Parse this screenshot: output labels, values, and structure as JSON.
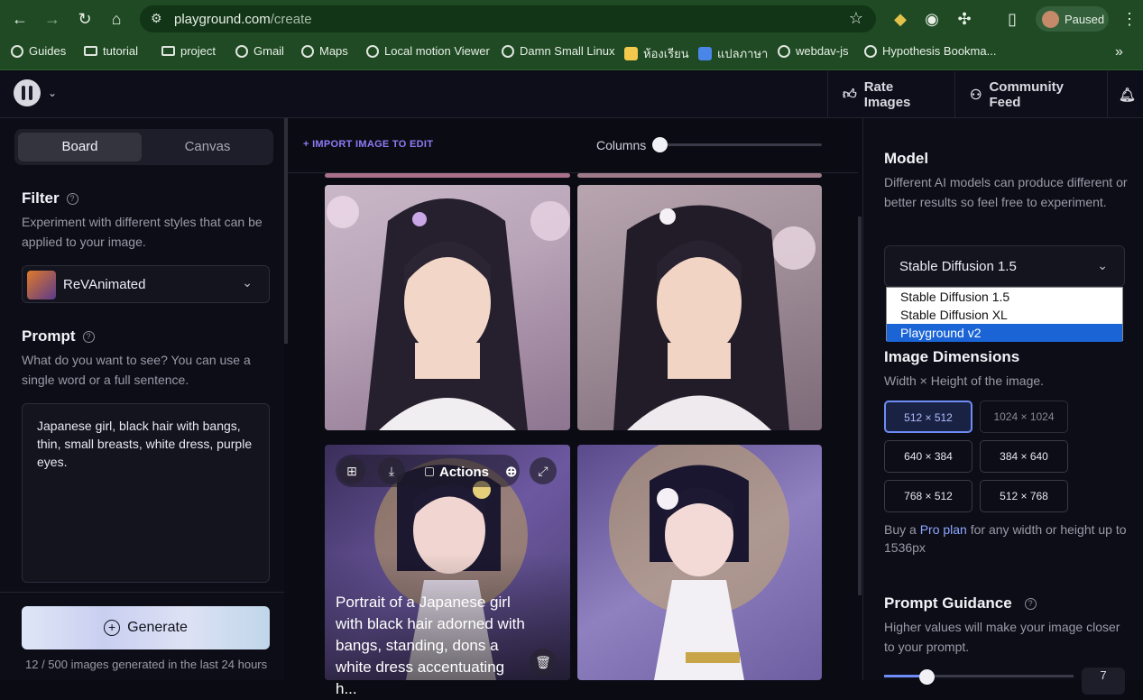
{
  "browser": {
    "url_host": "playground.com",
    "url_path": "/create",
    "profile_label": "Paused",
    "bookmarks": [
      {
        "label": "Guides",
        "icon": "globe-icon"
      },
      {
        "label": "tutorial",
        "icon": "folder-icon"
      },
      {
        "label": "project",
        "icon": "folder-icon"
      },
      {
        "label": "Gmail",
        "icon": "globe-icon"
      },
      {
        "label": "Maps",
        "icon": "globe-icon"
      },
      {
        "label": "Local motion Viewer",
        "icon": "globe-icon"
      },
      {
        "label": "Damn Small Linux",
        "icon": "globe-icon"
      },
      {
        "label": "ห้องเรียน",
        "icon": "classroom-icon"
      },
      {
        "label": "แปลภาษา",
        "icon": "translate-icon"
      },
      {
        "label": "webdav-js",
        "icon": "globe-icon"
      },
      {
        "label": "Hypothesis Bookma...",
        "icon": "globe-icon"
      }
    ]
  },
  "header": {
    "rate_images": "Rate Images",
    "community_feed": "Community Feed"
  },
  "left": {
    "tabs": [
      "Board",
      "Canvas"
    ],
    "filter_title": "Filter",
    "filter_desc": "Experiment with different styles that can be applied to your image.",
    "filter_value": "ReVAnimated",
    "prompt_title": "Prompt",
    "prompt_desc": "What do you want to see? You can use a single word or a full sentence.",
    "prompt_value": "Japanese girl, black hair with bangs, thin, small breasts, white dress, purple eyes.",
    "generate_label": "Generate",
    "generated_count": "12 / 500 images generated in the last 24 hours"
  },
  "center": {
    "import_label": "+ IMPORT IMAGE TO EDIT",
    "columns_label": "Columns",
    "actions_label": "Actions",
    "caption": "Portrait of a Japanese girl with black hair adorned with bangs, standing, dons a white dress accentuating h..."
  },
  "right": {
    "model_title": "Model",
    "model_desc": "Different AI models can produce different or better results so feel free to experiment.",
    "model_value": "Stable Diffusion 1.5",
    "model_options": [
      "Stable Diffusion 1.5",
      "Stable Diffusion XL",
      "Playground v2"
    ],
    "dimensions_title": "Image Dimensions",
    "dimensions_desc": "Width × Height of the image.",
    "dimensions": [
      "512 × 512",
      "1024 × 1024",
      "640 × 384",
      "384 × 640",
      "768 × 512",
      "512 × 768"
    ],
    "pro_prefix": "Buy a ",
    "pro_link": "Pro plan",
    "pro_suffix": " for any width or height up to 1536px",
    "guidance_title": "Prompt Guidance",
    "guidance_desc": "Higher values will make your image closer to your prompt.",
    "guidance_value": "7"
  },
  "colors": {
    "browser_green": "#1f4a23",
    "accent_purple": "#8b7cf6",
    "selected_blue": "#1a64d6"
  }
}
